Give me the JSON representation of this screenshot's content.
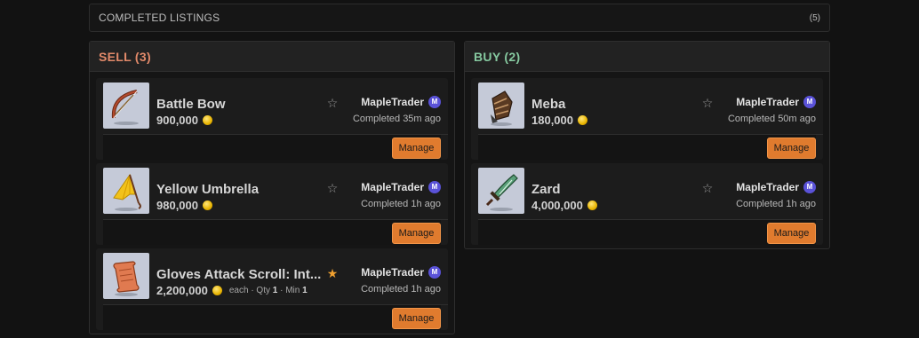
{
  "header": {
    "title": "COMPLETED LISTINGS",
    "count": "(5)"
  },
  "sell": {
    "title": "SELL (3)",
    "items": [
      {
        "name": "Battle Bow",
        "price": "900,000",
        "extra_each": "",
        "qty_label": "",
        "qty": "",
        "min_label": "",
        "min": "",
        "favorited": false,
        "seller": "MapleTrader",
        "badge": "M",
        "completed": "Completed 35m ago",
        "action": "Manage",
        "icon": "bow-icon"
      },
      {
        "name": "Yellow Umbrella",
        "price": "980,000",
        "extra_each": "",
        "qty_label": "",
        "qty": "",
        "min_label": "",
        "min": "",
        "favorited": false,
        "seller": "MapleTrader",
        "badge": "M",
        "completed": "Completed 1h ago",
        "action": "Manage",
        "icon": "umbrella-icon"
      },
      {
        "name": "Gloves Attack Scroll: Int...",
        "price": "2,200,000",
        "extra_each": "each",
        "qty_label": "· Qty",
        "qty": "1",
        "min_label": "· Min",
        "min": "1",
        "favorited": true,
        "seller": "MapleTrader",
        "badge": "M",
        "completed": "Completed 1h ago",
        "action": "Manage",
        "icon": "scroll-icon"
      }
    ]
  },
  "buy": {
    "title": "BUY (2)",
    "items": [
      {
        "name": "Meba",
        "price": "180,000",
        "favorited": false,
        "seller": "MapleTrader",
        "badge": "M",
        "completed": "Completed 50m ago",
        "action": "Manage",
        "icon": "glove-icon"
      },
      {
        "name": "Zard",
        "price": "4,000,000",
        "favorited": false,
        "seller": "MapleTrader",
        "badge": "M",
        "completed": "Completed 1h ago",
        "action": "Manage",
        "icon": "sword-icon"
      }
    ]
  },
  "colors": {
    "sell_accent": "#e28a6a",
    "buy_accent": "#86c9a0",
    "button": "#e07b2e",
    "badge": "#5a52d8",
    "star_on": "#f0a030"
  },
  "icons": {
    "star_empty": "☆",
    "star_filled": "★"
  }
}
